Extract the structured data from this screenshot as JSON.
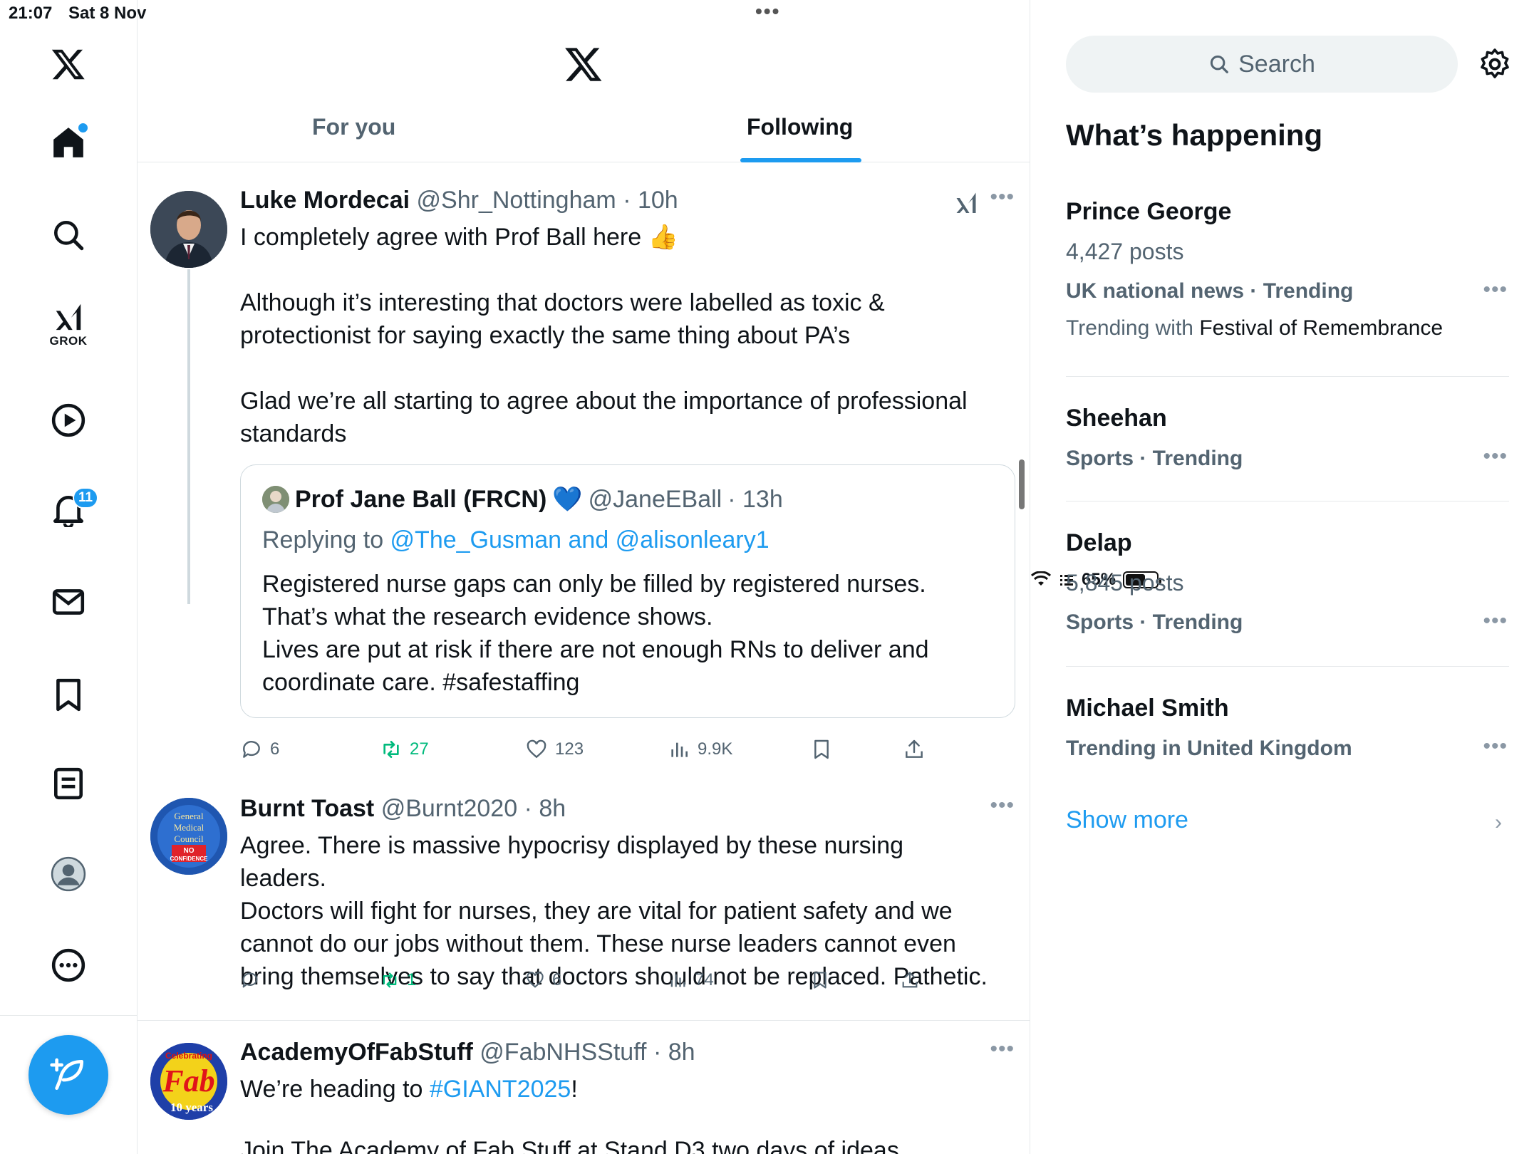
{
  "status_bar": {
    "time": "21:07",
    "date": "Sat 8 Nov",
    "battery": "65%",
    "battery_level": 0.65
  },
  "nav": {
    "items": [
      "home",
      "explore",
      "grok",
      "video",
      "notifications",
      "messages",
      "bookmarks",
      "lists",
      "profile",
      "more"
    ],
    "grok_label": "GROK",
    "notifications_badge": "11"
  },
  "tabs": {
    "for_you": "For you",
    "following": "Following",
    "active": "following"
  },
  "tweets": [
    {
      "name": "Luke Mordecai",
      "handle": "@Shr_Nottingham",
      "time": "· 10h",
      "text": "I completely agree with Prof Ball here 👍\n\nAlthough it’s interesting that doctors were labelled as toxic &\nprotectionist for saying exactly the same thing about PA’s\n\nGlad we’re all starting to agree about the importance of professional\nstandards",
      "quote": {
        "name": "Prof Jane Ball (FRCN)",
        "emoji": "💙",
        "handle": "@JaneEBall",
        "time": "· 13h",
        "replying_prefix": "Replying to ",
        "replying_to": "@The_Gusman and @alisonleary1",
        "text": "Registered nurse gaps can only be filled by registered nurses.\nThat’s what the research evidence shows.\nLives are put at risk if there are not enough RNs to deliver and\ncoordinate care. #safestaffing"
      },
      "replies": "6",
      "retweets": "27",
      "likes": "123",
      "views": "9.9K"
    },
    {
      "name": "Burnt Toast",
      "handle": "@Burnt2020",
      "time": "· 8h",
      "text": "Agree. There is massive hypocrisy displayed by these nursing leaders.\nDoctors will fight for nurses, they are vital for patient safety and we\ncannot do our jobs without them. These nurse leaders cannot even\nbring themselves to say that doctors should not be replaced. Pathetic.",
      "replies": "",
      "retweets": "1",
      "likes": "6",
      "views": "74",
      "avatar_text": [
        "General",
        "Medical",
        "Council",
        "NO",
        "CONFIDENCE"
      ]
    },
    {
      "name": "AcademyOfFabStuff",
      "handle": "@FabNHSStuff",
      "time": "· 8h",
      "text_before": "We’re heading to ",
      "hashtag": "#GIANT2025",
      "text_after": "!",
      "text_cut": "Join The Academy of Fab Stuff at Stand D3 two days of ideas",
      "avatar_text": [
        "Celebrating",
        "Fab",
        "10 years"
      ]
    }
  ],
  "sidebar": {
    "search_placeholder": "Search",
    "title": "What’s happening",
    "trends": [
      {
        "name": "Prince George",
        "posts": "4,427 posts",
        "category": "UK national news · Trending",
        "with_prefix": "Trending with ",
        "with": "Festival of Remembrance"
      },
      {
        "name": "Sheehan",
        "category": "Sports · Trending"
      },
      {
        "name": "Delap",
        "posts": "5,845 posts",
        "category": "Sports · Trending"
      },
      {
        "name": "Michael Smith",
        "category": "Trending in United Kingdom"
      }
    ],
    "show_more": "Show more"
  },
  "colors": {
    "accent": "#1d9bf0",
    "retweet": "#00ba7c",
    "muted": "#536471",
    "text": "#0f1419"
  }
}
